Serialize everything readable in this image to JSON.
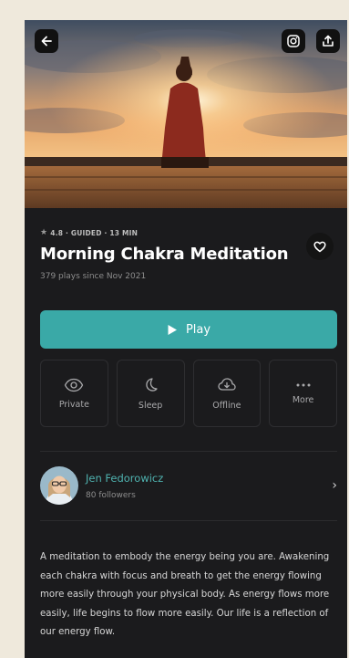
{
  "session": {
    "rating": "4.8",
    "meta_text": "4.8 · GUIDED · 13 MIN",
    "title": "Morning Chakra Meditation",
    "plays": "379 plays since Nov 2021"
  },
  "play_button": {
    "label": "Play"
  },
  "actions": [
    {
      "label": "Private",
      "icon": "eye-icon"
    },
    {
      "label": "Sleep",
      "icon": "moon-icon"
    },
    {
      "label": "Offline",
      "icon": "cloud-download-icon"
    },
    {
      "label": "More",
      "icon": "ellipsis-icon"
    }
  ],
  "author": {
    "name": "Jen Fedorowicz",
    "followers": "80 followers"
  },
  "description": "A meditation to embody the energy being you are. Awakening each chakra with focus and breath to get the energy flowing more easily through your physical body. As energy flows more easily, life begins to flow more easily. Our life is a reflection of our energy flow.",
  "colors": {
    "accent": "#3aa9a7",
    "author_link": "#4fb3b0",
    "background": "#1b1b1d"
  }
}
